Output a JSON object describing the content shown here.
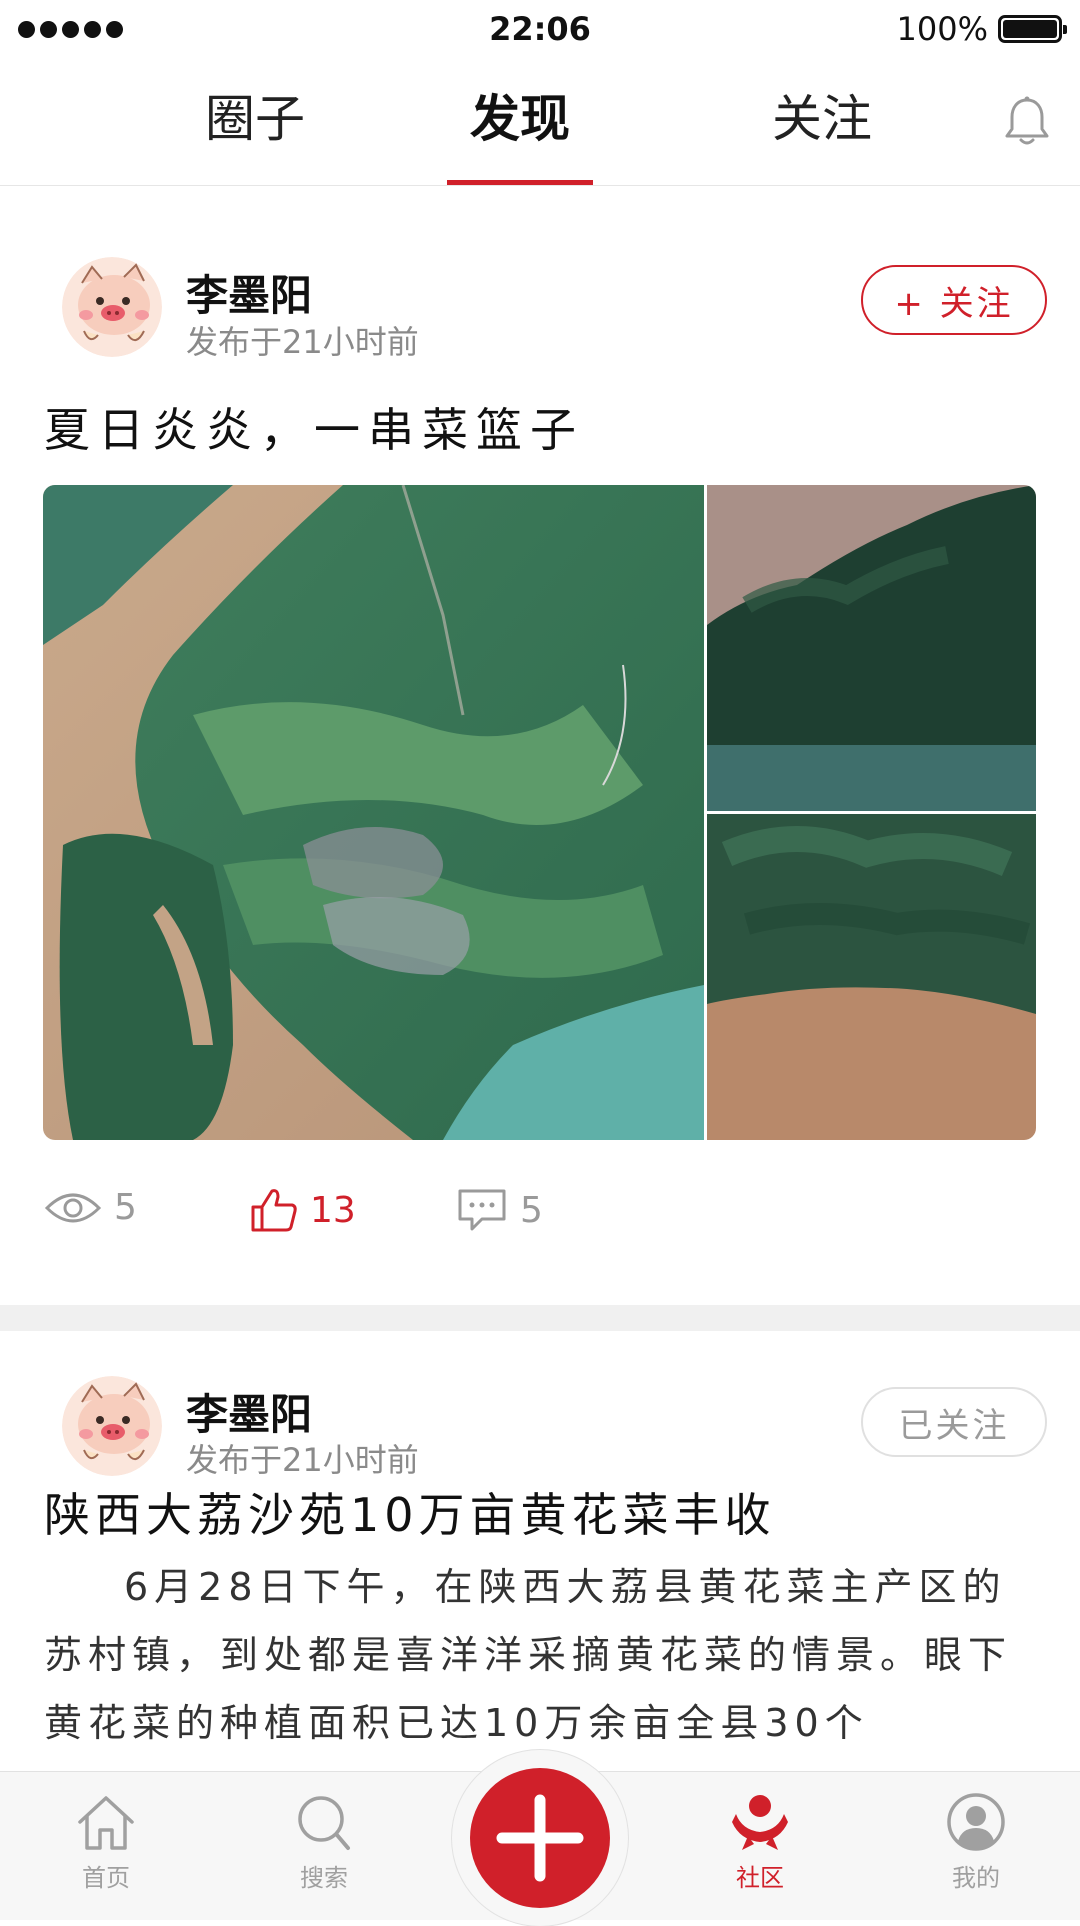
{
  "status_bar": {
    "time": "22:06",
    "battery": "100%"
  },
  "top_tabs": [
    {
      "label": "圈子",
      "active": false
    },
    {
      "label": "发现",
      "active": true
    },
    {
      "label": "关注",
      "active": false
    }
  ],
  "posts": [
    {
      "author": "李墨阳",
      "time": "发布于21小时前",
      "follow_label": "+ 关注",
      "title": "夏日炎炎，一串菜篮子",
      "stats": {
        "views": "5",
        "likes": "13",
        "comments": "5"
      }
    },
    {
      "author": "李墨阳",
      "time": "发布于21小时前",
      "follow_label": "已关注",
      "title": "陕西大荔沙苑10万亩黄花菜丰收",
      "body": "6月28日下午，在陕西大荔县黄花菜主产区的苏村镇，到处都是喜洋洋采摘黄花菜的情景。眼下黄花菜的种植面积已达10万余亩全县30个"
    }
  ],
  "bottom_nav": [
    {
      "label": "首页",
      "icon": "home-icon",
      "active": false
    },
    {
      "label": "搜索",
      "icon": "search-icon",
      "active": false
    },
    {
      "label": "社区",
      "icon": "community-icon",
      "active": true
    },
    {
      "label": "我的",
      "icon": "profile-icon",
      "active": false
    }
  ],
  "colors": {
    "accent": "#d0202a",
    "muted": "#9a9a9a"
  }
}
